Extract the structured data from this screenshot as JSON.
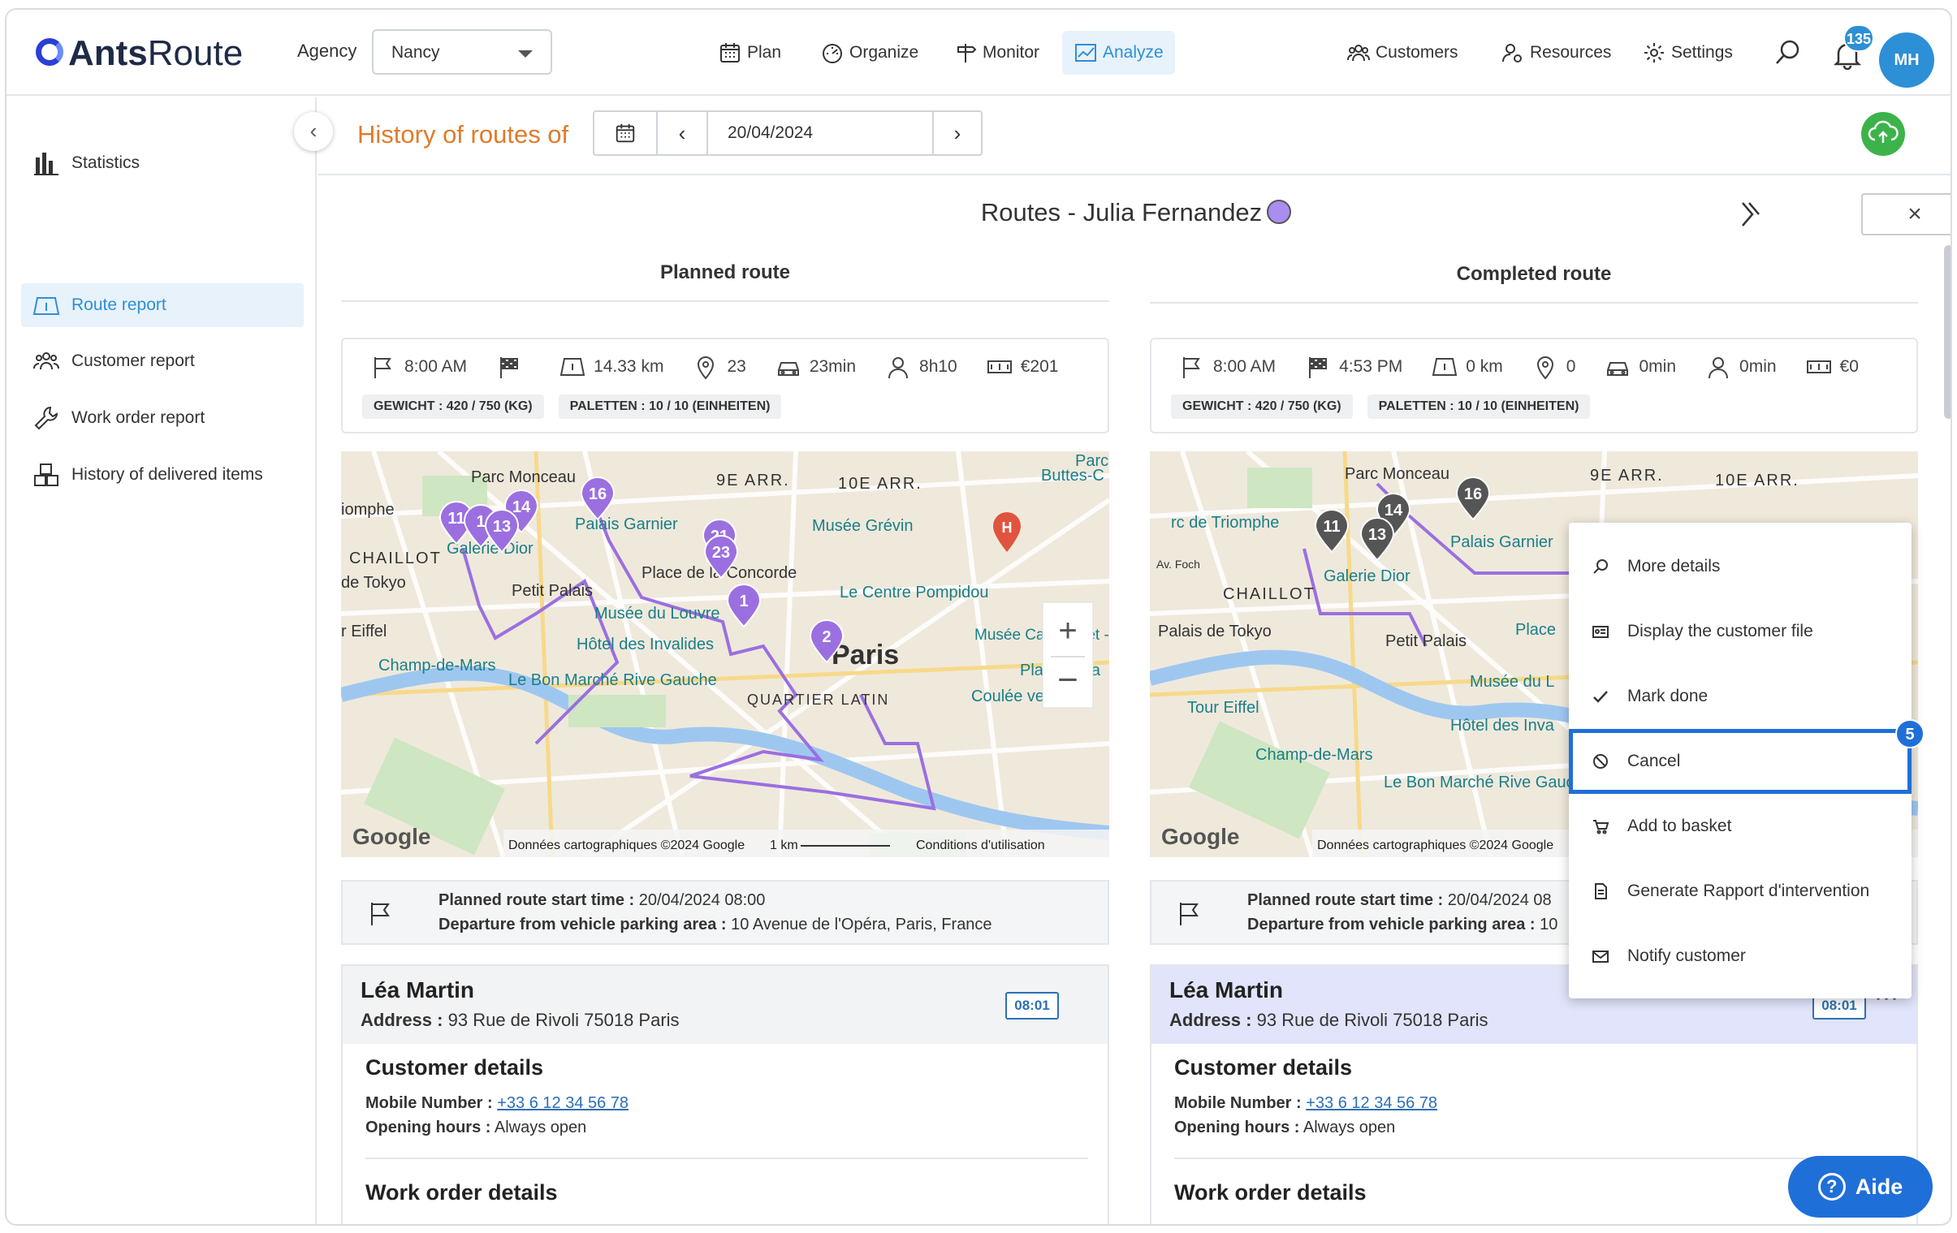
{
  "brand": {
    "name_a": "Ants",
    "name_b": "Route"
  },
  "header": {
    "agency_label": "Agency",
    "agency_value": "Nancy",
    "nav": [
      {
        "label": "Plan",
        "icon": "calendar-icon"
      },
      {
        "label": "Organize",
        "icon": "gauge-icon"
      },
      {
        "label": "Monitor",
        "icon": "signpost-icon"
      },
      {
        "label": "Analyze",
        "icon": "chart-line-icon",
        "active": true
      }
    ],
    "right_nav": [
      {
        "label": "Customers",
        "icon": "customers-icon"
      },
      {
        "label": "Resources",
        "icon": "resources-icon"
      },
      {
        "label": "Settings",
        "icon": "gear-icon"
      }
    ],
    "notification_count": "135",
    "user_initials": "MH"
  },
  "sidebar": {
    "items": [
      {
        "label": "Statistics",
        "icon": "bar-chart-icon"
      },
      {
        "label": "Route report",
        "icon": "route-map-icon",
        "active": true
      },
      {
        "label": "Customer report",
        "icon": "customers-icon"
      },
      {
        "label": "Work order report",
        "icon": "wrench-icon"
      },
      {
        "label": "History of delivered items",
        "icon": "boxes-icon"
      }
    ]
  },
  "history": {
    "title": "History of routes of",
    "date": "20/04/2024"
  },
  "panel": {
    "title": "Routes - Julia Fernandez",
    "close": "×",
    "next": "»"
  },
  "planned": {
    "heading": "Planned route",
    "stats": {
      "start": "8:00 AM",
      "end": "",
      "distance": "14.33 km",
      "stops": "23",
      "drive": "23min",
      "work": "8h10",
      "cost": "€201"
    },
    "pills": [
      "GEWICHT : 420 / 750 (KG)",
      "PALETTEN : 10 / 10 (EINHEITEN)"
    ],
    "start_time_label": "Planned route start time :",
    "start_time_value": "20/04/2024 08:00",
    "departure_label": "Departure from vehicle parking area :",
    "departure_value": "10 Avenue de l'Opéra, Paris, France",
    "map": {
      "copyright": "Données cartographiques ©2024 Google",
      "scale": "1 km",
      "terms": "Conditions d'utilisation",
      "google": "Google",
      "labels": [
        "Parc Monceau",
        "9E ARR.",
        "10E ARR.",
        "Musée Grévin",
        "CHAILLOT",
        "de Tokyo",
        "Petit Palais",
        "Place de la Concorde",
        "Le Centre Pompidou",
        "Musée du Louvre",
        "Hôtel des Invalides",
        "Champ-de-Mars",
        "Le Bon Marché Rive Gauche",
        "Paris",
        "QUARTIER LATIN",
        "Musée Carnavalet - Histoire de Paris",
        "Place de la",
        "Coulée verte",
        "r Eiffel",
        "iomphe",
        "Palais Garnier",
        "Galerie Dior",
        "Buttes-C",
        "Parc"
      ],
      "pins": [
        "16",
        "14",
        "11",
        "1",
        "13",
        "21",
        "23",
        "1",
        "2"
      ]
    }
  },
  "completed": {
    "heading": "Completed route",
    "stats": {
      "start": "8:00 AM",
      "end": "4:53 PM",
      "distance": "0 km",
      "stops": "0",
      "drive": "0min",
      "work": "0min",
      "cost": "€0"
    },
    "pills": [
      "GEWICHT : 420 / 750 (KG)",
      "PALETTEN : 10 / 10 (EINHEITEN)"
    ],
    "start_time_label": "Planned route start time :",
    "start_time_value": "20/04/2024 08",
    "departure_label": "Departure from vehicle parking area :",
    "departure_value": "10",
    "map": {
      "copyright": "Données cartographiques ©2024 Google",
      "google": "Google",
      "labels": [
        "Parc Monceau",
        "9E ARR.",
        "10E ARR.",
        "rc de Triomphe",
        "Palais Garnier",
        "Galerie Dior",
        "CHAILLOT",
        "Palais de Tokyo",
        "Petit Palais",
        "Tour Eiffel",
        "Musée du L",
        "Hôtel des Inva",
        "Champ-de-Mars",
        "Le Bon Marché Rive Gauche",
        "Place",
        "Av. Foch"
      ],
      "pins": [
        "16",
        "14",
        "11",
        "13"
      ]
    }
  },
  "stop": {
    "name": "Léa Martin",
    "address_label": "Address :",
    "address": "93 Rue de Rivoli 75018 Paris",
    "time": "08:01",
    "customer_details": "Customer details",
    "mobile_label": "Mobile Number :",
    "mobile": "+33 6 12 34 56 78",
    "hours_label": "Opening hours :",
    "hours": "Always open",
    "work_order": "Work order details"
  },
  "context_menu": {
    "items": [
      {
        "label": "More details",
        "icon": "magnifier-icon"
      },
      {
        "label": "Display the customer file",
        "icon": "id-card-icon"
      },
      {
        "label": "Mark done",
        "icon": "check-icon"
      },
      {
        "label": "Cancel",
        "icon": "ban-icon",
        "highlight": true
      },
      {
        "label": "Add to basket",
        "icon": "basket-icon"
      },
      {
        "label": "Generate Rapport d'intervention",
        "icon": "document-icon"
      },
      {
        "label": "Notify customer",
        "icon": "mail-icon"
      }
    ],
    "step": "5"
  },
  "help": {
    "label": "Aide"
  },
  "colors": {
    "accent": "#2d8fd5",
    "route": "#9b6fe0",
    "highlight": "#1f6fd8",
    "title_orange": "#e07b2a"
  }
}
